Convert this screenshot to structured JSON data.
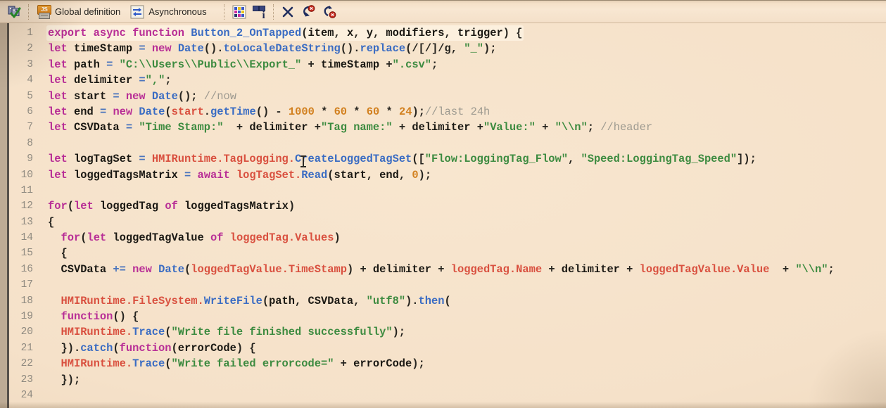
{
  "colors": {
    "keyword": "#b82e96",
    "function": "#3a6cc3",
    "string": "#3d8b40",
    "number": "#d2801f",
    "variable": "#1a1813",
    "objectref": "#d9503f",
    "comment": "#9d9a90",
    "operator": "#4a74bd",
    "plain": "#26241f",
    "background": "#f5e1c9",
    "line_highlight": "#fcf0de"
  },
  "toolbar": {
    "global_definition_label": "Global definition",
    "asynchronous_label": "Asynchronous",
    "icon_glyphs": {
      "js_badge": "JS",
      "info_letter": "i"
    }
  },
  "editor": {
    "lines": [
      {
        "n": "1",
        "hl": true,
        "seg": [
          [
            "kw",
            "export"
          ],
          [
            "pl",
            " "
          ],
          [
            "kw",
            "async"
          ],
          [
            "pl",
            " "
          ],
          [
            "kw",
            "function"
          ],
          [
            "pl",
            " "
          ],
          [
            "fn",
            "Button_2_OnTapped"
          ],
          [
            "pl",
            "("
          ],
          [
            "vr",
            "item"
          ],
          [
            "pl",
            ", "
          ],
          [
            "vr",
            "x"
          ],
          [
            "pl",
            ", "
          ],
          [
            "vr",
            "y"
          ],
          [
            "pl",
            ", "
          ],
          [
            "vr",
            "modifiers"
          ],
          [
            "pl",
            ", "
          ],
          [
            "vr",
            "trigger"
          ],
          [
            "pl",
            ") {"
          ]
        ]
      },
      {
        "n": "2",
        "seg": [
          [
            "kw",
            "let"
          ],
          [
            "pl",
            " "
          ],
          [
            "vr",
            "timeStamp"
          ],
          [
            "pl",
            " "
          ],
          [
            "op",
            "="
          ],
          [
            "pl",
            " "
          ],
          [
            "kw",
            "new"
          ],
          [
            "pl",
            " "
          ],
          [
            "fn",
            "Date"
          ],
          [
            "pl",
            "()."
          ],
          [
            "fn",
            "toLocaleDateString"
          ],
          [
            "pl",
            "()."
          ],
          [
            "fn",
            "replace"
          ],
          [
            "pl",
            "(/[/]/g, "
          ],
          [
            "st",
            "\"_\""
          ],
          [
            "pl",
            ");"
          ]
        ]
      },
      {
        "n": "3",
        "seg": [
          [
            "kw",
            "let"
          ],
          [
            "pl",
            " "
          ],
          [
            "vr",
            "path"
          ],
          [
            "pl",
            " "
          ],
          [
            "op",
            "="
          ],
          [
            "pl",
            " "
          ],
          [
            "st",
            "\"C:\\\\Users\\\\Public\\\\Export_\""
          ],
          [
            "pl",
            " + "
          ],
          [
            "vr",
            "timeStamp"
          ],
          [
            "pl",
            " +"
          ],
          [
            "st",
            "\".csv\""
          ],
          [
            "pl",
            ";"
          ]
        ]
      },
      {
        "n": "4",
        "seg": [
          [
            "kw",
            "let"
          ],
          [
            "pl",
            " "
          ],
          [
            "vr",
            "delimiter"
          ],
          [
            "pl",
            " "
          ],
          [
            "op",
            "="
          ],
          [
            "st",
            "\",\""
          ],
          [
            "pl",
            ";"
          ]
        ]
      },
      {
        "n": "5",
        "seg": [
          [
            "kw",
            "let"
          ],
          [
            "pl",
            " "
          ],
          [
            "vr",
            "start"
          ],
          [
            "pl",
            " "
          ],
          [
            "op",
            "="
          ],
          [
            "pl",
            " "
          ],
          [
            "kw",
            "new"
          ],
          [
            "pl",
            " "
          ],
          [
            "fn",
            "Date"
          ],
          [
            "pl",
            "(); "
          ],
          [
            "cm",
            "//now"
          ]
        ]
      },
      {
        "n": "6",
        "seg": [
          [
            "kw",
            "let"
          ],
          [
            "pl",
            " "
          ],
          [
            "vr",
            "end"
          ],
          [
            "pl",
            " "
          ],
          [
            "op",
            "="
          ],
          [
            "pl",
            " "
          ],
          [
            "kw",
            "new"
          ],
          [
            "pl",
            " "
          ],
          [
            "fn",
            "Date"
          ],
          [
            "pl",
            "("
          ],
          [
            "ob",
            "start"
          ],
          [
            "pl",
            "."
          ],
          [
            "fn",
            "getTime"
          ],
          [
            "pl",
            "() - "
          ],
          [
            "nm",
            "1000"
          ],
          [
            "pl",
            " * "
          ],
          [
            "nm",
            "60"
          ],
          [
            "pl",
            " * "
          ],
          [
            "nm",
            "60"
          ],
          [
            "pl",
            " * "
          ],
          [
            "nm",
            "24"
          ],
          [
            "pl",
            ");"
          ],
          [
            "cm",
            "//last 24h"
          ]
        ]
      },
      {
        "n": "7",
        "seg": [
          [
            "kw",
            "let"
          ],
          [
            "pl",
            " "
          ],
          [
            "vr",
            "CSVData"
          ],
          [
            "pl",
            " "
          ],
          [
            "op",
            "="
          ],
          [
            "pl",
            " "
          ],
          [
            "st",
            "\"Time Stamp:\""
          ],
          [
            "pl",
            "  + "
          ],
          [
            "vr",
            "delimiter"
          ],
          [
            "pl",
            " +"
          ],
          [
            "st",
            "\"Tag name:\""
          ],
          [
            "pl",
            " + "
          ],
          [
            "vr",
            "delimiter"
          ],
          [
            "pl",
            " +"
          ],
          [
            "st",
            "\"Value:\""
          ],
          [
            "pl",
            " + "
          ],
          [
            "st",
            "\"\\\\n\""
          ],
          [
            "pl",
            "; "
          ],
          [
            "cm",
            "//header"
          ]
        ]
      },
      {
        "n": "8",
        "seg": []
      },
      {
        "n": "9",
        "seg": [
          [
            "kw",
            "let"
          ],
          [
            "pl",
            " "
          ],
          [
            "vr",
            "logTagSet"
          ],
          [
            "pl",
            " "
          ],
          [
            "op",
            "="
          ],
          [
            "pl",
            " "
          ],
          [
            "ob",
            "HMIRuntime.TagLogging."
          ],
          [
            "fn",
            "CreateLoggedTagSet"
          ],
          [
            "pl",
            "(["
          ],
          [
            "st",
            "\"Flow:LoggingTag_Flow\""
          ],
          [
            "pl",
            ", "
          ],
          [
            "st",
            "\"Speed:LoggingTag_Speed\""
          ],
          [
            "pl",
            "]);"
          ]
        ]
      },
      {
        "n": "10",
        "seg": [
          [
            "kw",
            "let"
          ],
          [
            "pl",
            " "
          ],
          [
            "vr",
            "loggedTagsMatrix"
          ],
          [
            "pl",
            " "
          ],
          [
            "op",
            "="
          ],
          [
            "pl",
            " "
          ],
          [
            "kw",
            "await"
          ],
          [
            "pl",
            " "
          ],
          [
            "ob",
            "logTagSet."
          ],
          [
            "fn",
            "Read"
          ],
          [
            "pl",
            "("
          ],
          [
            "vr",
            "start"
          ],
          [
            "pl",
            ", "
          ],
          [
            "vr",
            "end"
          ],
          [
            "pl",
            ", "
          ],
          [
            "nm",
            "0"
          ],
          [
            "pl",
            ");"
          ]
        ]
      },
      {
        "n": "11",
        "seg": []
      },
      {
        "n": "12",
        "seg": [
          [
            "kw",
            "for"
          ],
          [
            "pl",
            "("
          ],
          [
            "kw",
            "let"
          ],
          [
            "pl",
            " "
          ],
          [
            "vr",
            "loggedTag"
          ],
          [
            "pl",
            " "
          ],
          [
            "kw",
            "of"
          ],
          [
            "pl",
            " "
          ],
          [
            "vr",
            "loggedTagsMatrix"
          ],
          [
            "pl",
            ")"
          ]
        ]
      },
      {
        "n": "13",
        "seg": [
          [
            "pl",
            "{"
          ]
        ]
      },
      {
        "n": "14",
        "seg": [
          [
            "pl",
            "  "
          ],
          [
            "kw",
            "for"
          ],
          [
            "pl",
            "("
          ],
          [
            "kw",
            "let"
          ],
          [
            "pl",
            " "
          ],
          [
            "vr",
            "loggedTagValue"
          ],
          [
            "pl",
            " "
          ],
          [
            "kw",
            "of"
          ],
          [
            "pl",
            " "
          ],
          [
            "ob",
            "loggedTag.Values"
          ],
          [
            "pl",
            ")"
          ]
        ]
      },
      {
        "n": "15",
        "seg": [
          [
            "pl",
            "  {"
          ]
        ]
      },
      {
        "n": "16",
        "seg": [
          [
            "pl",
            "  "
          ],
          [
            "vr",
            "CSVData"
          ],
          [
            "pl",
            " "
          ],
          [
            "op",
            "+="
          ],
          [
            "pl",
            " "
          ],
          [
            "kw",
            "new"
          ],
          [
            "pl",
            " "
          ],
          [
            "fn",
            "Date"
          ],
          [
            "pl",
            "("
          ],
          [
            "ob",
            "loggedTagValue.TimeStamp"
          ],
          [
            "pl",
            ") + "
          ],
          [
            "vr",
            "delimiter"
          ],
          [
            "pl",
            " + "
          ],
          [
            "ob",
            "loggedTag.Name"
          ],
          [
            "pl",
            " + "
          ],
          [
            "vr",
            "delimiter"
          ],
          [
            "pl",
            " + "
          ],
          [
            "ob",
            "loggedTagValue.Value"
          ],
          [
            "pl",
            "  + "
          ],
          [
            "st",
            "\"\\\\n\""
          ],
          [
            "pl",
            ";"
          ]
        ]
      },
      {
        "n": "17",
        "seg": []
      },
      {
        "n": "18",
        "seg": [
          [
            "pl",
            "  "
          ],
          [
            "ob",
            "HMIRuntime.FileSystem."
          ],
          [
            "fn",
            "WriteFile"
          ],
          [
            "pl",
            "("
          ],
          [
            "vr",
            "path"
          ],
          [
            "pl",
            ", "
          ],
          [
            "vr",
            "CSVData"
          ],
          [
            "pl",
            ", "
          ],
          [
            "st",
            "\"utf8\""
          ],
          [
            "pl",
            ")."
          ],
          [
            "fn",
            "then"
          ],
          [
            "pl",
            "("
          ]
        ]
      },
      {
        "n": "19",
        "seg": [
          [
            "pl",
            "  "
          ],
          [
            "kw",
            "function"
          ],
          [
            "pl",
            "() {"
          ]
        ]
      },
      {
        "n": "20",
        "seg": [
          [
            "pl",
            "  "
          ],
          [
            "ob",
            "HMIRuntime."
          ],
          [
            "fn",
            "Trace"
          ],
          [
            "pl",
            "("
          ],
          [
            "st",
            "\"Write file finished successfully\""
          ],
          [
            "pl",
            ");"
          ]
        ]
      },
      {
        "n": "21",
        "seg": [
          [
            "pl",
            "  })."
          ],
          [
            "fn",
            "catch"
          ],
          [
            "pl",
            "("
          ],
          [
            "kw",
            "function"
          ],
          [
            "pl",
            "("
          ],
          [
            "vr",
            "errorCode"
          ],
          [
            "pl",
            ") {"
          ]
        ]
      },
      {
        "n": "22",
        "seg": [
          [
            "pl",
            "  "
          ],
          [
            "ob",
            "HMIRuntime."
          ],
          [
            "fn",
            "Trace"
          ],
          [
            "pl",
            "("
          ],
          [
            "st",
            "\"Write failed errorcode=\""
          ],
          [
            "pl",
            " + "
          ],
          [
            "vr",
            "errorCode"
          ],
          [
            "pl",
            ");"
          ]
        ]
      },
      {
        "n": "23",
        "seg": [
          [
            "pl",
            "  });"
          ]
        ]
      },
      {
        "n": "24",
        "seg": []
      }
    ]
  }
}
